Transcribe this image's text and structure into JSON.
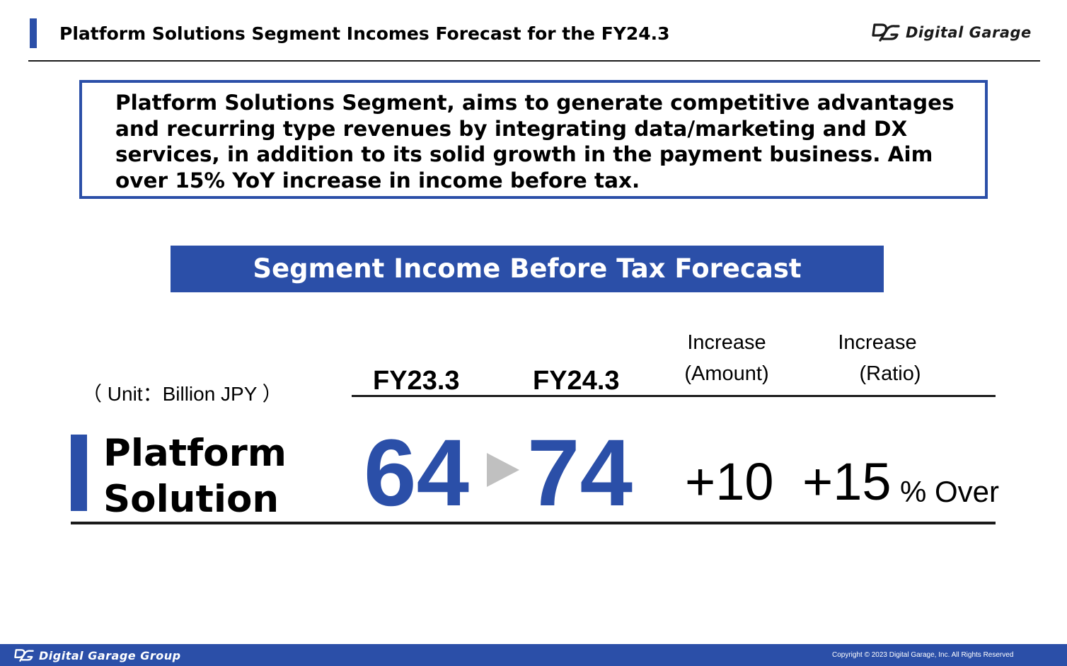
{
  "header": {
    "title": "Platform Solutions Segment Incomes Forecast for the FY24.3",
    "brand": "Digital Garage",
    "logo_icon": "dg-logo-icon"
  },
  "message": "Platform Solutions Segment, aims to generate competitive advantages and recurring type revenues by integrating data/marketing and DX services, in addition to its solid growth in the payment business. Aim over 15% YoY increase in income before tax.",
  "section": {
    "title": "Segment Income Before Tax Forecast"
  },
  "table": {
    "unit": "（ Unit：Billion JPY ）",
    "columns": {
      "fy23": "FY23.3",
      "fy24": "FY24.3",
      "amount_line1": "Increase",
      "amount_line2": "(Amount)",
      "ratio_line1": "Increase",
      "ratio_line2": "(Ratio)"
    },
    "row": {
      "label_line1": "Platform",
      "label_line2": "Solution",
      "fy23_value": "64",
      "fy24_value": "74",
      "arrow_icon": "triangle-right-icon",
      "increase_amount": "+10",
      "increase_ratio": "+15",
      "ratio_suffix": "% Over"
    }
  },
  "footer": {
    "brand": "Digital Garage Group",
    "copyright": "Copyright © 2023 Digital Garage, Inc. All Rights Reserved"
  },
  "colors": {
    "accent": "#2b4fa8",
    "text": "#000000",
    "arrow": "#c0c0c0"
  }
}
